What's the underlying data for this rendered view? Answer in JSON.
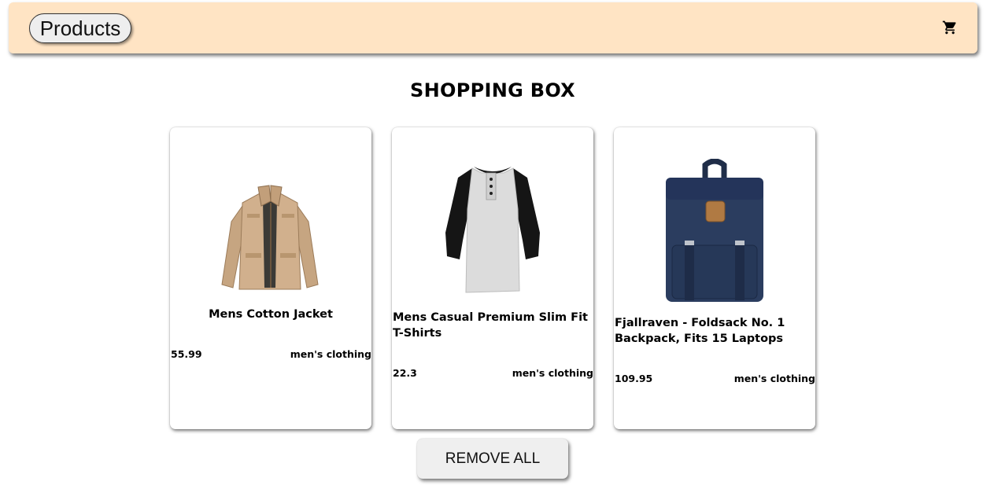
{
  "nav": {
    "products_label": "Products",
    "cart_icon": "shopping-cart-icon",
    "background_color": "#ffe4c4"
  },
  "page": {
    "title": "SHOPPING BOX"
  },
  "cart_items": [
    {
      "title": "Mens Cotton Jacket",
      "price": "55.99",
      "category": "men's clothing",
      "image": "jacket-image"
    },
    {
      "title": "Mens Casual Premium Slim Fit T-Shirts",
      "price": "22.3",
      "category": "men's clothing",
      "image": "tshirt-image"
    },
    {
      "title": "Fjallraven - Foldsack No. 1 Backpack, Fits 15 Laptops",
      "price": "109.95",
      "category": "men's clothing",
      "image": "backpack-image"
    }
  ],
  "actions": {
    "remove_all_label": "REMOVE ALL"
  }
}
